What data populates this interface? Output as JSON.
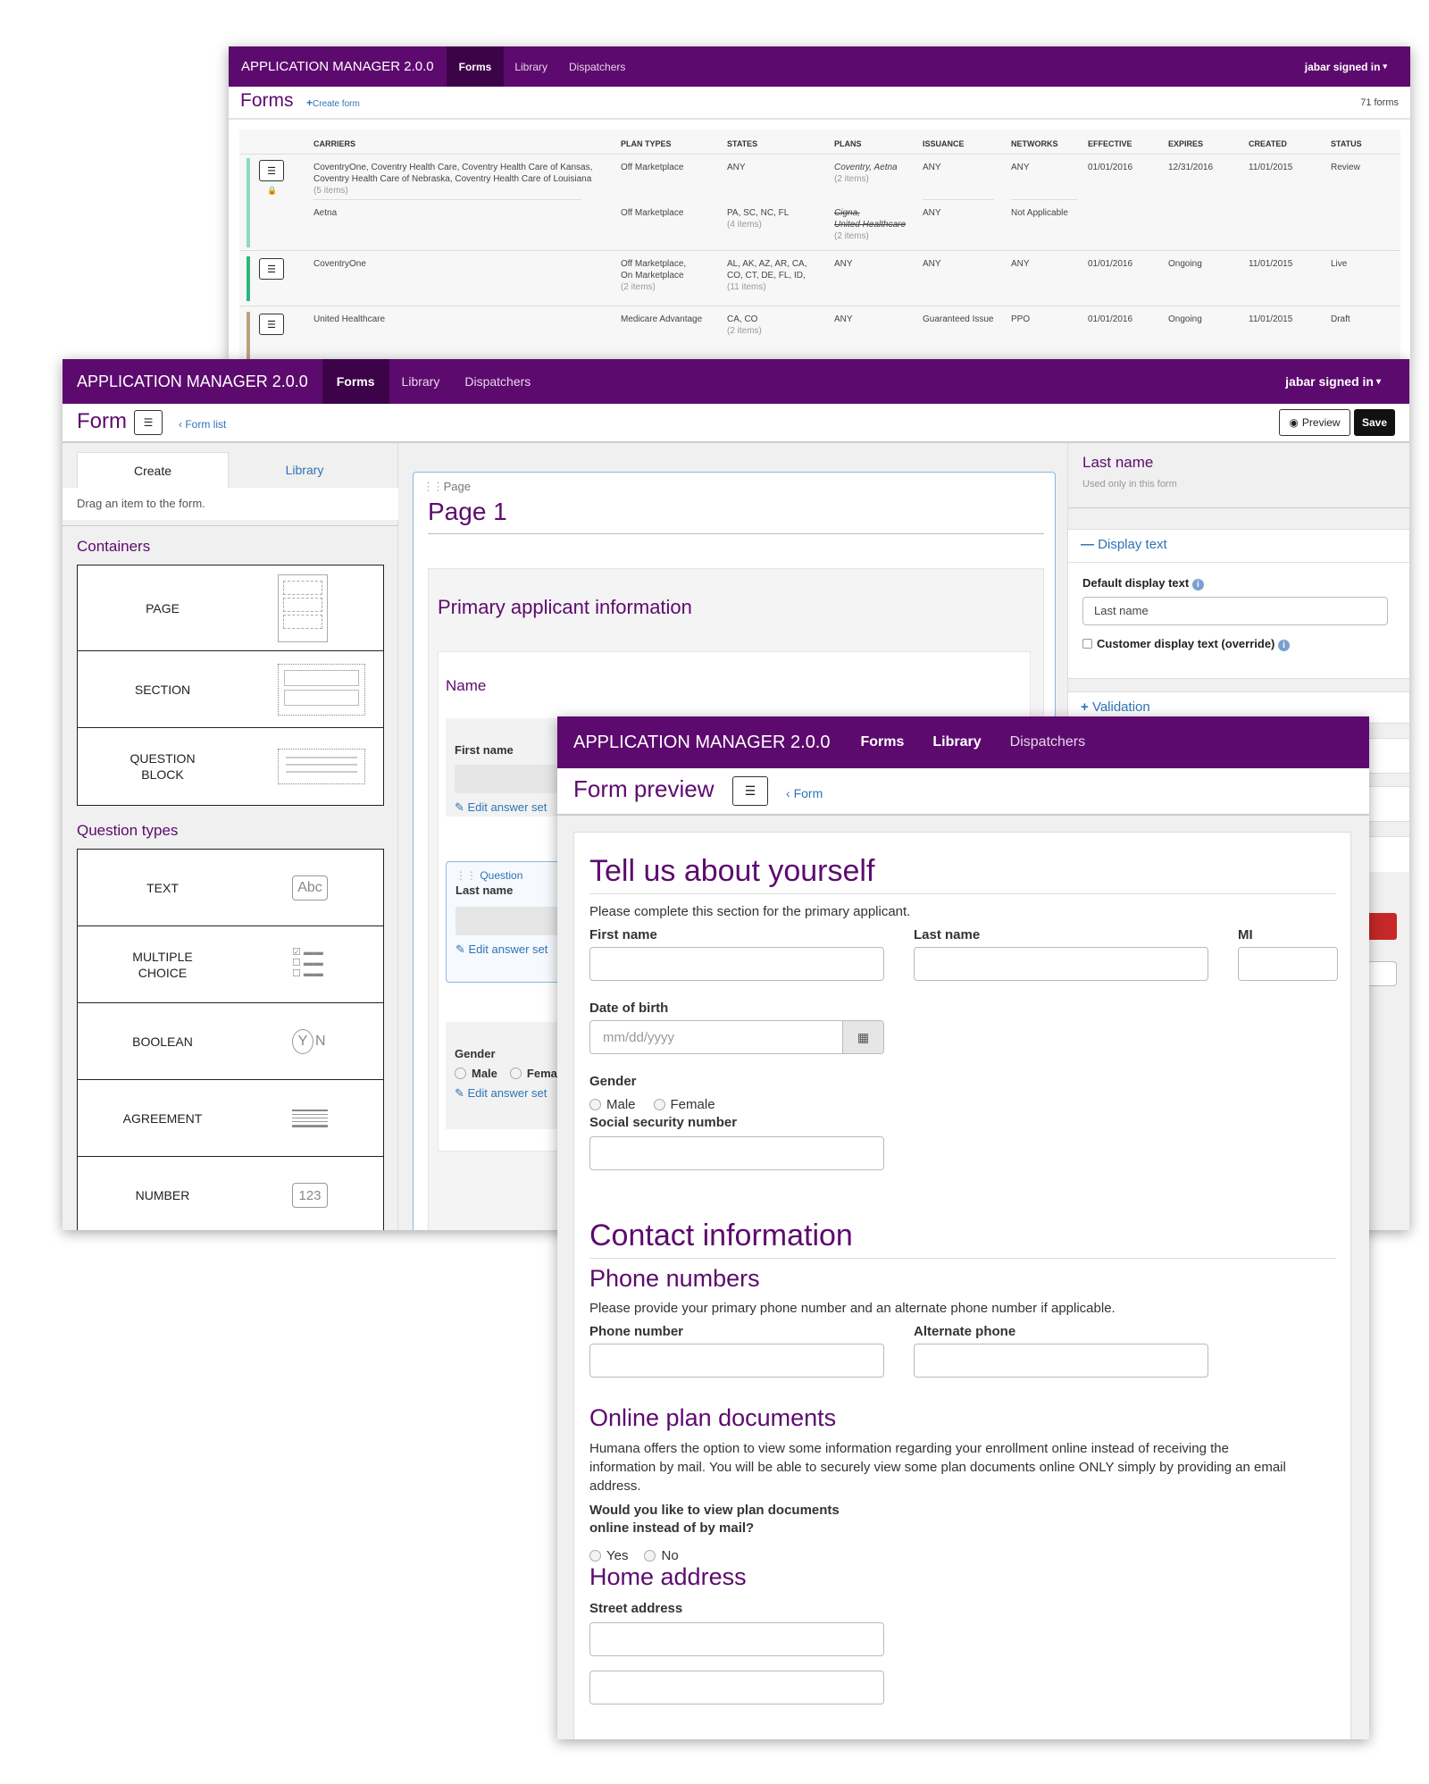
{
  "app": {
    "title": "APPLICATION MANAGER 2.0.0",
    "nav": [
      "Forms",
      "Library",
      "Dispatchers"
    ],
    "user": "jabar signed in"
  },
  "list": {
    "title": "Forms",
    "create": "Create form",
    "count": "71 forms",
    "columns": [
      "CARRIERS",
      "PLAN TYPES",
      "STATES",
      "PLANS",
      "ISSUANCE",
      "NETWORKS",
      "EFFECTIVE",
      "EXPIRES",
      "CREATED",
      "STATUS"
    ],
    "rows": [
      {
        "carrier1": "CoventryOne, Coventry Health Care, Coventry Health Care of Kansas,",
        "carrier2": "Coventry Health Care of Nebraska, Coventry Health Care of Louisiana",
        "carrier_count": "(5 items)",
        "plan_type": "Off Marketplace",
        "states": "ANY",
        "plans": "Coventry, Aetna",
        "plans_count": "(2 items)",
        "issuance": "ANY",
        "networks": "ANY",
        "effective": "01/01/2016",
        "expires": "12/31/2016",
        "created": "11/01/2015",
        "status": "Review",
        "sub": {
          "carrier": "Aetna",
          "plan_type": "Off Marketplace",
          "states": "PA, SC, NC, FL",
          "states_count": "(4 items)",
          "plan1": "Cigna,",
          "plan2": "United Healthcare",
          "plans_count": "(2 items)",
          "issuance": "ANY",
          "networks": "Not Applicable"
        }
      },
      {
        "carrier1": "CoventryOne",
        "plan_type1": "Off Marketplace,",
        "plan_type2": "On Marketplace",
        "plan_type_count": "(2 items)",
        "states1": "AL, AK, AZ, AR, CA,",
        "states2": "CO, CT, DE, FL, ID,",
        "states_count": "(11 items)",
        "plans": "ANY",
        "issuance": "ANY",
        "networks": "ANY",
        "effective": "01/01/2016",
        "expires": "Ongoing",
        "created": "11/01/2015",
        "status": "Live"
      },
      {
        "carrier1": "United Healthcare",
        "plan_type1": "Medicare Advantage",
        "states1": "CA, CO",
        "states_count": "(2 items)",
        "plans": "ANY",
        "issuance": "Guaranteed Issue",
        "networks": "PPO",
        "effective": "01/01/2016",
        "expires": "Ongoing",
        "created": "11/01/2015",
        "status": "Draft"
      }
    ],
    "row_colors": [
      "#8fd9bf",
      "#2cb57f",
      "#b9a47f"
    ]
  },
  "builder": {
    "title": "Form",
    "back": "Form list",
    "preview": "Preview",
    "save": "Save",
    "tabs": [
      "Create",
      "Library"
    ],
    "hint": "Drag an item to the form.",
    "containers_heading": "Containers",
    "containers": [
      "PAGE",
      "SECTION",
      "QUESTION BLOCK"
    ],
    "types_heading": "Question types",
    "types": [
      "TEXT",
      "MULTIPLE CHOICE",
      "BOOLEAN",
      "AGREEMENT",
      "NUMBER"
    ],
    "icons": {
      "text": "Abc",
      "boolean_y": "Y",
      "boolean_n": "N",
      "number": "123"
    },
    "canvas": {
      "page_label": "Page",
      "page_title": "Page 1",
      "section_title": "Primary applicant information",
      "block_title": "Name",
      "q1_label": "First name",
      "edit_link": "Edit answer set",
      "q2_tag": "Question",
      "q2_label": "Last name",
      "q3_label": "Gender",
      "male": "Male",
      "female": "Female"
    },
    "props": {
      "title": "Last name",
      "subtitle": "Used only in this form",
      "display_text": "Display text",
      "default_label": "Default display text",
      "default_value": "Last name",
      "override_label": "Customer display text (override)",
      "validation": "Validation"
    }
  },
  "preview": {
    "title": "Form preview",
    "back": "Form",
    "heading1": "Tell us about yourself",
    "intro": "Please complete this section for the primary applicant.",
    "first": "First name",
    "last": "Last name",
    "mi": "MI",
    "dob": "Date of birth",
    "dob_placeholder": "mm/dd/yyyy",
    "gender": "Gender",
    "male": "Male",
    "female": "Female",
    "ssn": "Social security number",
    "heading2": "Contact information",
    "phones_heading": "Phone numbers",
    "phones_text": "Please provide your primary phone number and an alternate phone number if applicable.",
    "phone": "Phone number",
    "alt_phone": "Alternate phone",
    "docs_heading": "Online plan documents",
    "docs_text1": "Humana offers the option to view some information regarding your enrollment online instead of receiving the",
    "docs_text2": "information by mail. You will be able to securely view some plan documents online ONLY simply by providing an email",
    "docs_text3": "address.",
    "docs_q1": "Would you like to view plan documents",
    "docs_q2": "online instead of by mail?",
    "yes": "Yes",
    "no": "No",
    "address_heading": "Home address",
    "street": "Street address"
  }
}
